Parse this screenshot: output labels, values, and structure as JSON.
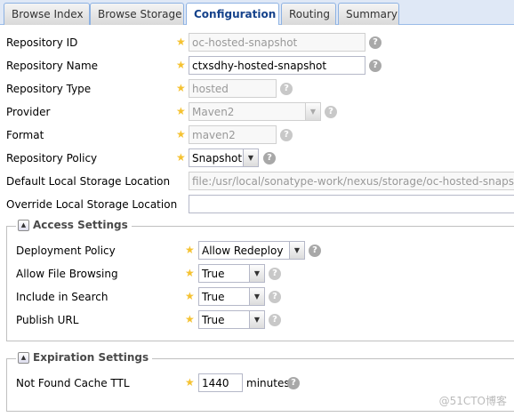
{
  "tabs": [
    "Browse Index",
    "Browse Storage",
    "Configuration",
    "Routing",
    "Summary"
  ],
  "fields": {
    "repo_id": {
      "label": "Repository ID",
      "value": "oc-hosted-snapshot"
    },
    "repo_name": {
      "label": "Repository Name",
      "value": "ctxsdhy-hosted-snapshot"
    },
    "repo_type": {
      "label": "Repository Type",
      "value": "hosted"
    },
    "provider": {
      "label": "Provider",
      "value": "Maven2"
    },
    "format": {
      "label": "Format",
      "value": "maven2"
    },
    "repo_policy": {
      "label": "Repository Policy",
      "value": "Snapshot"
    },
    "default_storage": {
      "label": "Default Local Storage Location",
      "value": "file:/usr/local/sonatype-work/nexus/storage/oc-hosted-snapshot"
    },
    "override_storage": {
      "label": "Override Local Storage Location",
      "value": ""
    }
  },
  "access": {
    "title": "Access Settings",
    "deployment_policy": {
      "label": "Deployment Policy",
      "value": "Allow Redeploy"
    },
    "file_browsing": {
      "label": "Allow File Browsing",
      "value": "True"
    },
    "include_search": {
      "label": "Include in Search",
      "value": "True"
    },
    "publish_url": {
      "label": "Publish URL",
      "value": "True"
    }
  },
  "expiration": {
    "title": "Expiration Settings",
    "not_found_ttl": {
      "label": "Not Found Cache TTL",
      "value": "1440",
      "unit": "minutes"
    }
  },
  "glyphs": {
    "star": "★",
    "help": "?",
    "arrow": "▼",
    "collapse": "▲"
  },
  "watermark": "@51CTO博客",
  "colors": {
    "accent": "#15428b",
    "required_star": "#f5c231"
  }
}
